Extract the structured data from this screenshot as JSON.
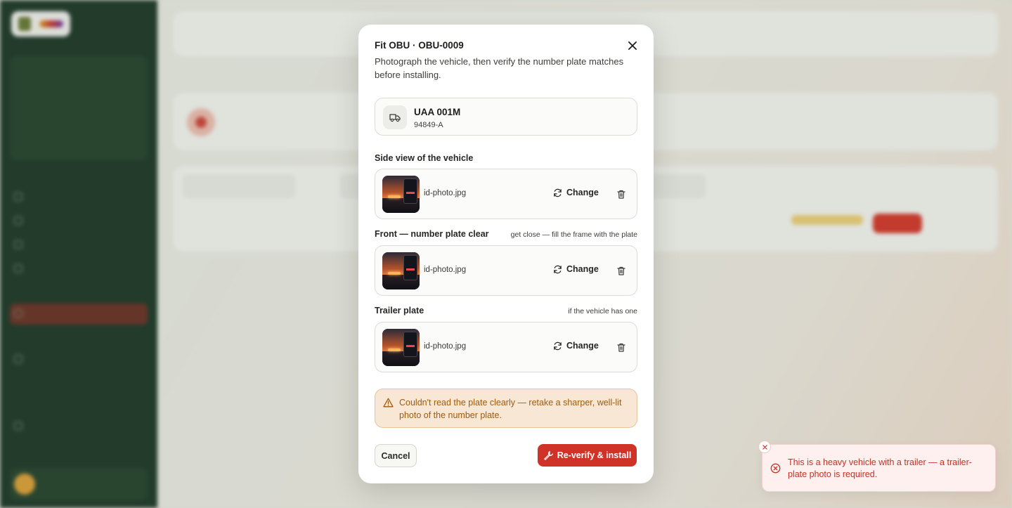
{
  "modal": {
    "title": "Fit OBU · OBU-0009",
    "description": "Photograph the vehicle, then verify the number plate matches before installing.",
    "vehicle": {
      "plate": "UAA 001M",
      "fleet_number": "94849-A",
      "icon": "truck-icon"
    },
    "sections": [
      {
        "label": "Side view of the vehicle",
        "hint": "",
        "file_name": "id-photo.jpg",
        "change_label": "Change"
      },
      {
        "label": "Front — number plate clear",
        "hint": "get close — fill the frame with the plate",
        "file_name": "id-photo.jpg",
        "change_label": "Change"
      },
      {
        "label": "Trailer plate",
        "hint": "if the vehicle has one",
        "file_name": "id-photo.jpg",
        "change_label": "Change"
      }
    ],
    "warning": "Couldn't read the plate clearly — retake a sharper, well-lit photo of the number plate.",
    "cancel_label": "Cancel",
    "submit_label": "Re-verify & install"
  },
  "toast": {
    "message": "This is a heavy vehicle with a trailer — a trailer-plate photo is required."
  },
  "colors": {
    "accent": "#cf3327",
    "warning_text": "#a05a0c",
    "warning_bg": "#f8e7d5",
    "error_text": "#c43226",
    "sidebar_bg": "#1f3a2a"
  }
}
